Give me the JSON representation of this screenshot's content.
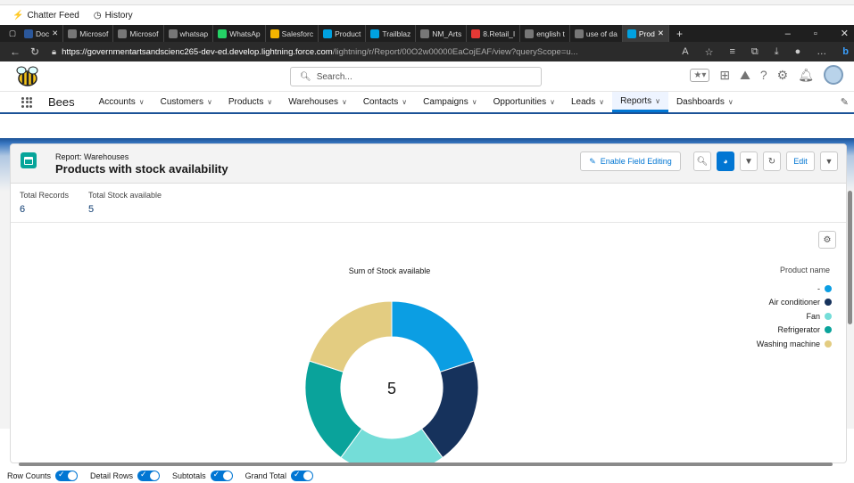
{
  "browser": {
    "chatter": {
      "feed": "Chatter Feed",
      "history": "History"
    },
    "tabs": [
      {
        "label": "Doc",
        "color": "#2b579a"
      },
      {
        "label": "Microsof",
        "color": "#777"
      },
      {
        "label": "Microsof",
        "color": "#777"
      },
      {
        "label": "whatsap",
        "color": "#777"
      },
      {
        "label": "WhatsAp",
        "color": "#25d366"
      },
      {
        "label": "Salesforc",
        "color": "#f4b400"
      },
      {
        "label": "Product",
        "color": "#00a1e0"
      },
      {
        "label": "Trailblaz",
        "color": "#00a1e0"
      },
      {
        "label": "NM_Arts",
        "color": "#777"
      },
      {
        "label": "8.Retail_I",
        "color": "#e53935"
      },
      {
        "label": "english t",
        "color": "#777"
      },
      {
        "label": "use of da",
        "color": "#777"
      },
      {
        "label": "Prod",
        "color": "#00a1e0"
      }
    ],
    "url_host": "https://governmentartsandscienc265-dev-ed.develop.lightning.force.com",
    "url_path": "/lightning/r/Report/00O2w00000EaCojEAF/view?queryScope=u..."
  },
  "header": {
    "search_placeholder": "Search..."
  },
  "nav": {
    "app": "Bees",
    "items": [
      {
        "label": "Accounts",
        "chevron": true
      },
      {
        "label": "Customers",
        "chevron": true
      },
      {
        "label": "Products",
        "chevron": true
      },
      {
        "label": "Warehouses",
        "chevron": true
      },
      {
        "label": "Contacts",
        "chevron": true
      },
      {
        "label": "Campaigns",
        "chevron": true
      },
      {
        "label": "Opportunities",
        "chevron": true
      },
      {
        "label": "Leads",
        "chevron": true
      },
      {
        "label": "Reports",
        "chevron": true,
        "active": true
      },
      {
        "label": "Dashboards",
        "chevron": true
      }
    ]
  },
  "report": {
    "subtitle": "Report: Warehouses",
    "title": "Products with stock availability",
    "enable_field_editing": "Enable Field Editing",
    "edit": "Edit",
    "totals": [
      {
        "label": "Total Records",
        "value": "6"
      },
      {
        "label": "Total Stock available",
        "value": "5"
      }
    ]
  },
  "chart_data": {
    "type": "pie",
    "subtype": "donut",
    "title": "Sum of Stock available",
    "center_value": "5",
    "legend_title": "Product name",
    "legend_position": "right",
    "categories": [
      "-",
      "Air conditioner",
      "Fan",
      "Refrigerator",
      "Washing machine"
    ],
    "values": [
      1,
      1,
      1,
      1,
      1
    ],
    "colors": [
      "#0b9ee3",
      "#16325c",
      "#74ddd8",
      "#0aa39b",
      "#e3cc81"
    ]
  },
  "footer": {
    "toggles": [
      {
        "label": "Row Counts"
      },
      {
        "label": "Detail Rows"
      },
      {
        "label": "Subtotals"
      },
      {
        "label": "Grand Total"
      }
    ]
  }
}
